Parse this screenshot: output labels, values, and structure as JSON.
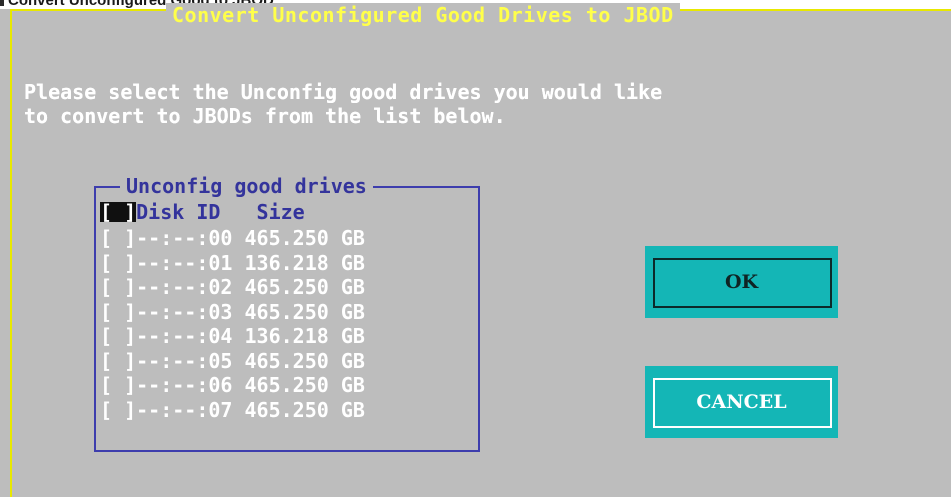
{
  "window": {
    "title": "Convert Unconfigured Good to JBOD"
  },
  "dialog": {
    "title": "Convert Unconfigured Good Drives to JBOD",
    "message_line1": "Please select the Unconfig good drives you would like",
    "message_line2": "to convert to JBODs from the list below."
  },
  "drive_list": {
    "label": "Unconfig good drives",
    "header_checkbox": "[ ]",
    "columns": [
      "Disk ID",
      "Size"
    ],
    "rows": [
      {
        "checkbox": "[ ]",
        "disk_id": "--:--:00",
        "size": "465.250 GB"
      },
      {
        "checkbox": "[ ]",
        "disk_id": "--:--:01",
        "size": "136.218 GB"
      },
      {
        "checkbox": "[ ]",
        "disk_id": "--:--:02",
        "size": "465.250 GB"
      },
      {
        "checkbox": "[ ]",
        "disk_id": "--:--:03",
        "size": "465.250 GB"
      },
      {
        "checkbox": "[ ]",
        "disk_id": "--:--:04",
        "size": "136.218 GB"
      },
      {
        "checkbox": "[ ]",
        "disk_id": "--:--:05",
        "size": "465.250 GB"
      },
      {
        "checkbox": "[ ]",
        "disk_id": "--:--:06",
        "size": "465.250 GB"
      },
      {
        "checkbox": "[ ]",
        "disk_id": "--:--:07",
        "size": "465.250 GB"
      }
    ]
  },
  "buttons": {
    "ok": "OK",
    "cancel": "CANCEL"
  },
  "colors": {
    "background": "#bdbdbd",
    "title_yellow": "#ffff4a",
    "group_blue": "#3d3dad",
    "button_cyan": "#14b6b6"
  }
}
